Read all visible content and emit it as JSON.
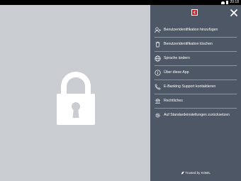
{
  "statusbar": {
    "time": "20:18"
  },
  "menu": {
    "items": [
      {
        "label": "Benutzeridentifikation hinzufügen",
        "icon": "add-user-icon"
      },
      {
        "label": "Benutzeridentifikation löschen",
        "icon": "trash-icon"
      },
      {
        "label": "Sprache ändern",
        "icon": "globe-icon"
      },
      {
        "label": "Über diese App",
        "icon": "info-icon"
      },
      {
        "label": "E-Banking Support kontaktieren",
        "icon": "phone-icon"
      },
      {
        "label": "Rechtliches",
        "icon": "legal-icon"
      },
      {
        "label": "Auf Standardeinstellungen zurücksetzen",
        "icon": "settings-icon"
      }
    ]
  },
  "footer": {
    "text": "Trusted by KOBIL"
  },
  "colors": {
    "drawer": "#4d5766",
    "background": "#c9ccd1",
    "brand": "#d21f26"
  }
}
